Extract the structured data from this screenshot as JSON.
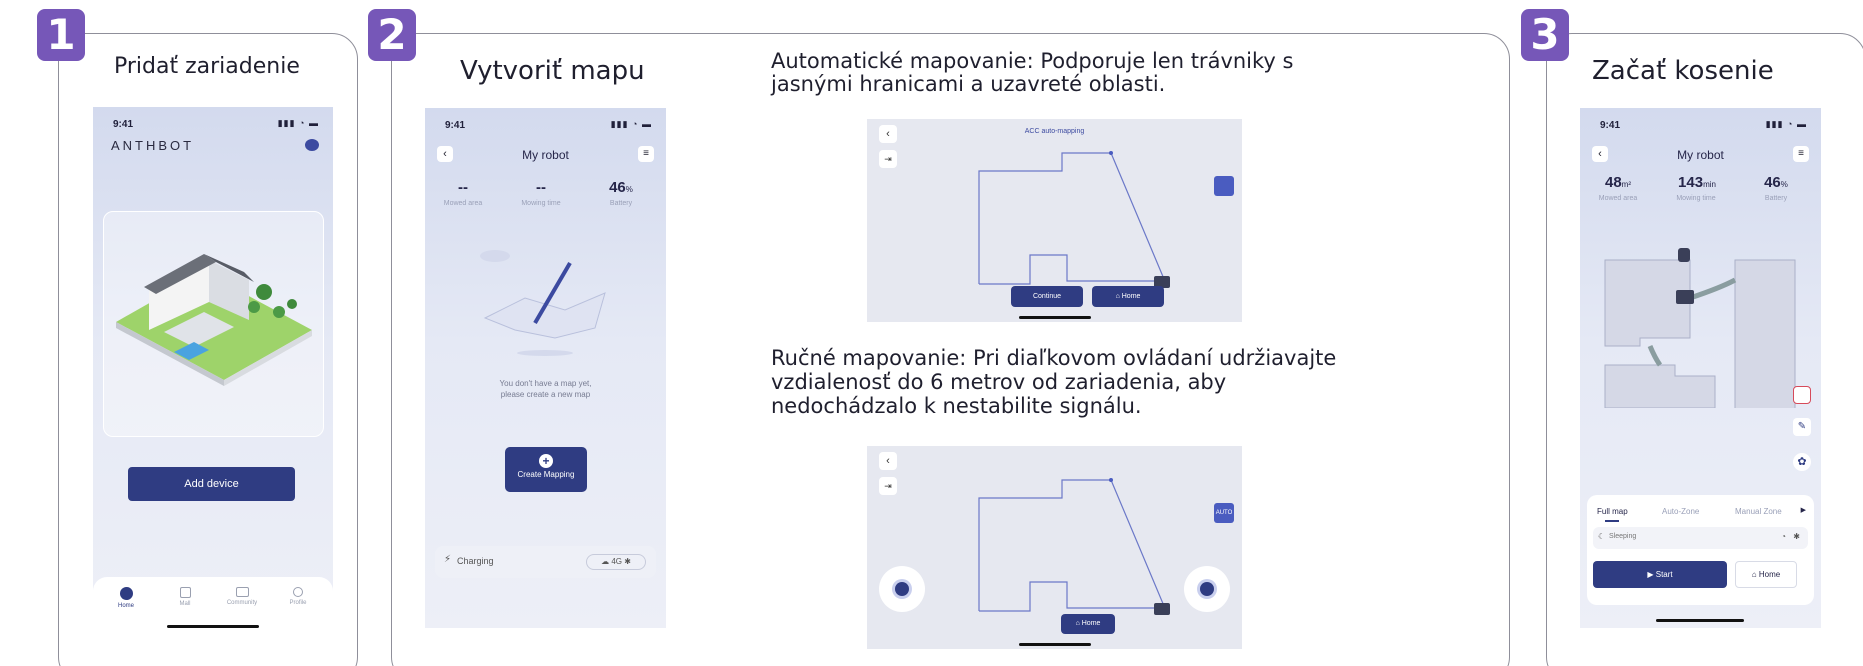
{
  "steps": [
    {
      "number": "1",
      "title": "Pridať zariadenie"
    },
    {
      "number": "2",
      "title": "Vytvoriť mapu"
    },
    {
      "number": "3",
      "title": "Začať kosenie"
    }
  ],
  "phone1": {
    "time": "9:41",
    "logo": "ANTHBOT",
    "add_device": "Add device",
    "tabs": [
      "Home",
      "Mall",
      "Community",
      "Profile"
    ]
  },
  "phone2": {
    "time": "9:41",
    "title": "My robot",
    "stats": [
      {
        "value": "--",
        "unit": "",
        "label": "Mowed area"
      },
      {
        "value": "--",
        "unit": "",
        "label": "Mowing time"
      },
      {
        "value": "46",
        "unit": "%",
        "label": "Battery"
      }
    ],
    "empty_line1": "You don't have a map yet,",
    "empty_line2": "please create a new map",
    "create_mapping": "Create Mapping",
    "charging": "Charging",
    "signal": "4G"
  },
  "auto_mapping": {
    "text_line1": "Automatické mapovanie: Podporuje len trávniky s",
    "text_line2": "jasnými hranicami a uzavreté oblasti.",
    "map_title": "ACC auto-mapping",
    "continue": "Continue",
    "home": "Home"
  },
  "manual_mapping": {
    "text_line1": "Ručné mapovanie: Pri diaľkovom ovládaní udržiavajte",
    "text_line2": "vzdialenosť do 6 metrov od zariadenia, aby",
    "text_line3": "nedochádzalo k nestabilite signálu.",
    "auto_badge": "AUTO",
    "home": "Home"
  },
  "phone3": {
    "time": "9:41",
    "title": "My robot",
    "stats": [
      {
        "value": "48",
        "unit": "m²",
        "label": "Mowed area"
      },
      {
        "value": "143",
        "unit": "min",
        "label": "Mowing time"
      },
      {
        "value": "46",
        "unit": "%",
        "label": "Battery"
      }
    ],
    "map_tabs": [
      "Full map",
      "Auto-Zone",
      "Manual Zone"
    ],
    "status": "Sleeping",
    "start": "Start",
    "home": "Home"
  }
}
